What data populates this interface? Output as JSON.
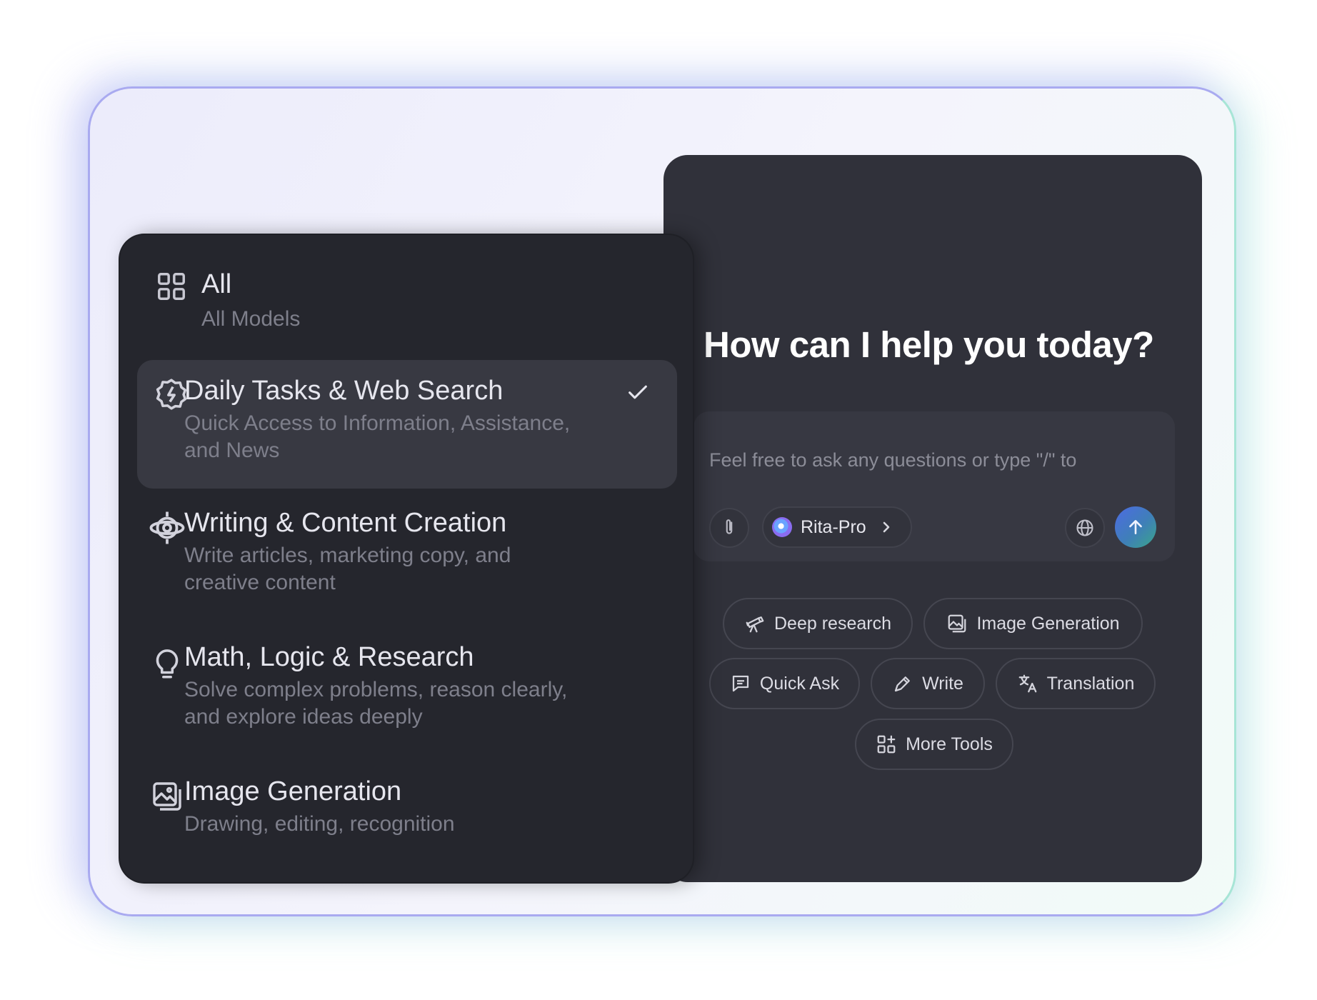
{
  "menu": {
    "items": [
      {
        "title": "All",
        "description": "All Models",
        "icon": "grid-icon",
        "selected": false
      },
      {
        "title": "Daily Tasks & Web Search",
        "description": "Quick Access to Information, Assistance, and News",
        "icon": "bolt-badge-icon",
        "selected": true
      },
      {
        "title": "Writing & Content Creation",
        "description": "Write articles, marketing copy, and creative content",
        "icon": "orbit-icon",
        "selected": false
      },
      {
        "title": "Math, Logic & Research",
        "description": "Solve complex problems, reason clearly, and explore ideas deeply",
        "icon": "lightbulb-icon",
        "selected": false
      },
      {
        "title": "Image Generation",
        "description": "Drawing, editing, recognition",
        "icon": "image-stack-icon",
        "selected": false
      }
    ]
  },
  "chat": {
    "title": "How can I help you today?",
    "input_placeholder": "Feel free to ask any questions or type \"/\" to",
    "model_name": "Rita-Pro",
    "chips": [
      {
        "label": "Deep research",
        "icon": "telescope-icon"
      },
      {
        "label": "Image Generation",
        "icon": "image-stack-icon"
      },
      {
        "label": "Quick Ask",
        "icon": "chat-bubble-icon"
      },
      {
        "label": "Write",
        "icon": "pen-icon"
      },
      {
        "label": "Translation",
        "icon": "translate-icon"
      },
      {
        "label": "More Tools",
        "icon": "grid-plus-icon"
      }
    ]
  },
  "colors": {
    "panel": "#30313a",
    "menu": "#25262d",
    "selected_row": "#383942",
    "send_gradient_start": "#4d6be3",
    "send_gradient_end": "#3aa58a"
  }
}
